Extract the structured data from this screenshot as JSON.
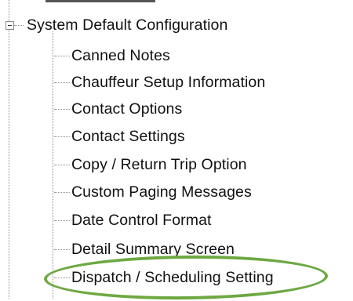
{
  "tree": {
    "parent": {
      "label": "System Default Configuration",
      "expanded": true
    },
    "children": [
      {
        "label": "Canned Notes"
      },
      {
        "label": "Chauffeur Setup Information"
      },
      {
        "label": "Contact Options"
      },
      {
        "label": "Contact Settings"
      },
      {
        "label": "Copy / Return Trip Option"
      },
      {
        "label": "Custom Paging Messages"
      },
      {
        "label": "Date Control Format"
      },
      {
        "label": "Detail Summary Screen"
      },
      {
        "label": "Dispatch / Scheduling Setting"
      }
    ],
    "highlighted_item": "Dispatch / Scheduling Setting",
    "highlight_color": "#6ea843"
  }
}
